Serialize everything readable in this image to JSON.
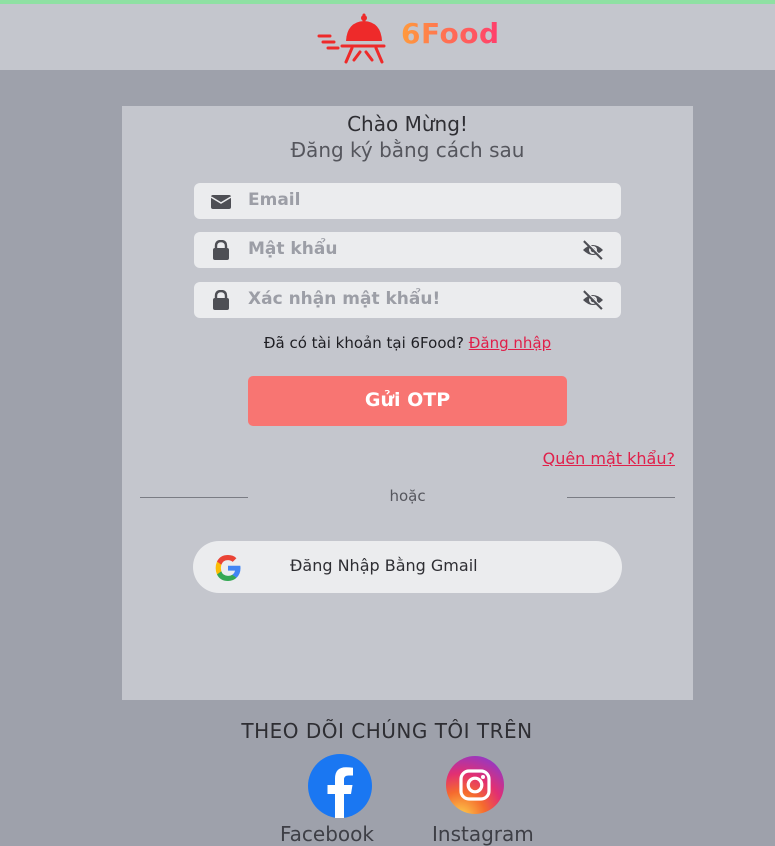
{
  "header": {
    "brand": "6Food"
  },
  "card": {
    "greeting": "Chào Mừng!",
    "subtitle": "Đăng ký bằng cách sau",
    "email_placeholder": "Email",
    "password_placeholder": "Mật khẩu",
    "confirm_placeholder": "Xác nhận mật khẩu!",
    "have_account": "Đã có tài khoản tại 6Food?",
    "login_link": "Đăng nhập",
    "otp_button": "Gửi OTP",
    "forgot_link": "Quên mật khẩu?",
    "or_text": "hoặc",
    "google_button": "Đăng Nhập Bằng Gmail"
  },
  "footer": {
    "follow_title": "THEO DÕI CHÚNG TÔI TRÊN",
    "facebook_label": "Facebook",
    "instagram_label": "Instagram"
  },
  "colors": {
    "accent": "#f87572",
    "link": "#e0204a",
    "background": "#9ea1ab",
    "panel": "#c4c6cd"
  },
  "icons": [
    "restaurant-cloche-logo-icon",
    "envelope-icon",
    "lock-icon",
    "eye-slash-icon",
    "google-icon",
    "facebook-icon",
    "instagram-icon"
  ]
}
